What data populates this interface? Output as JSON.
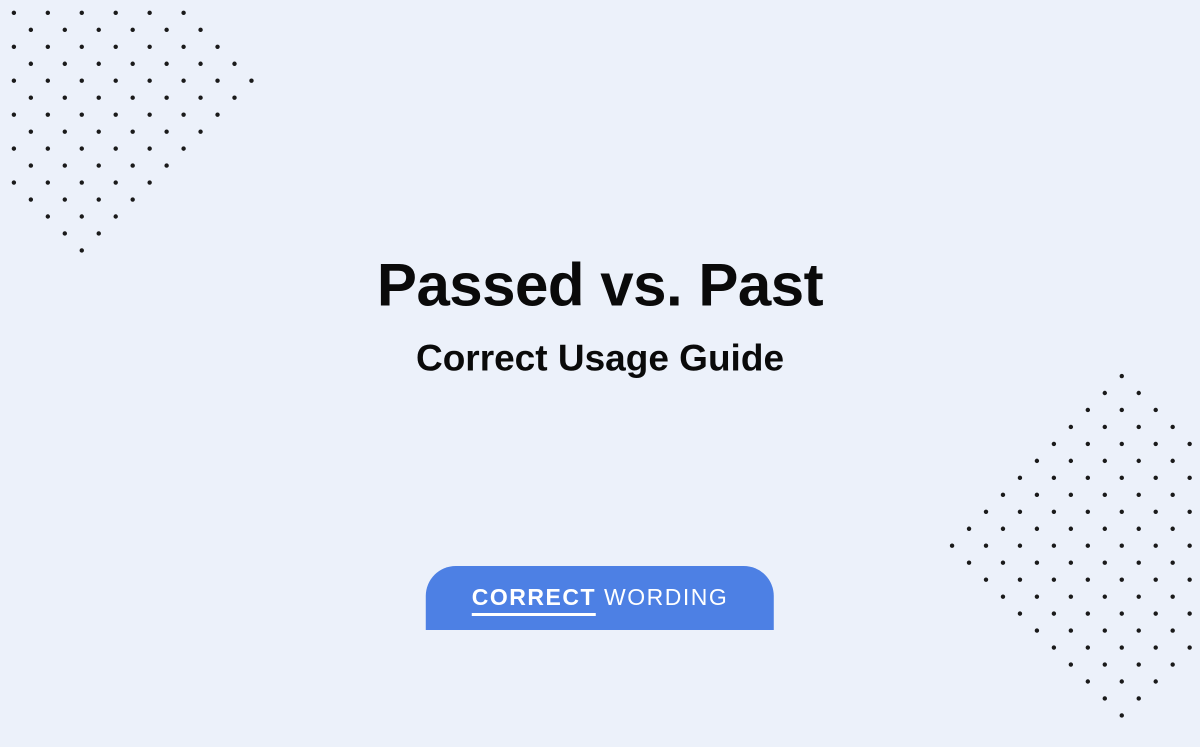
{
  "title": "Passed vs. Past",
  "subtitle": "Correct Usage Guide",
  "badge": {
    "word1": "CORRECT",
    "word2": "WORDING"
  },
  "colors": {
    "background": "#ecf1fa",
    "text": "#0a0a0a",
    "badge_bg": "#4d80e4",
    "badge_text": "#ffffff",
    "dot": "#1a1a1a"
  }
}
